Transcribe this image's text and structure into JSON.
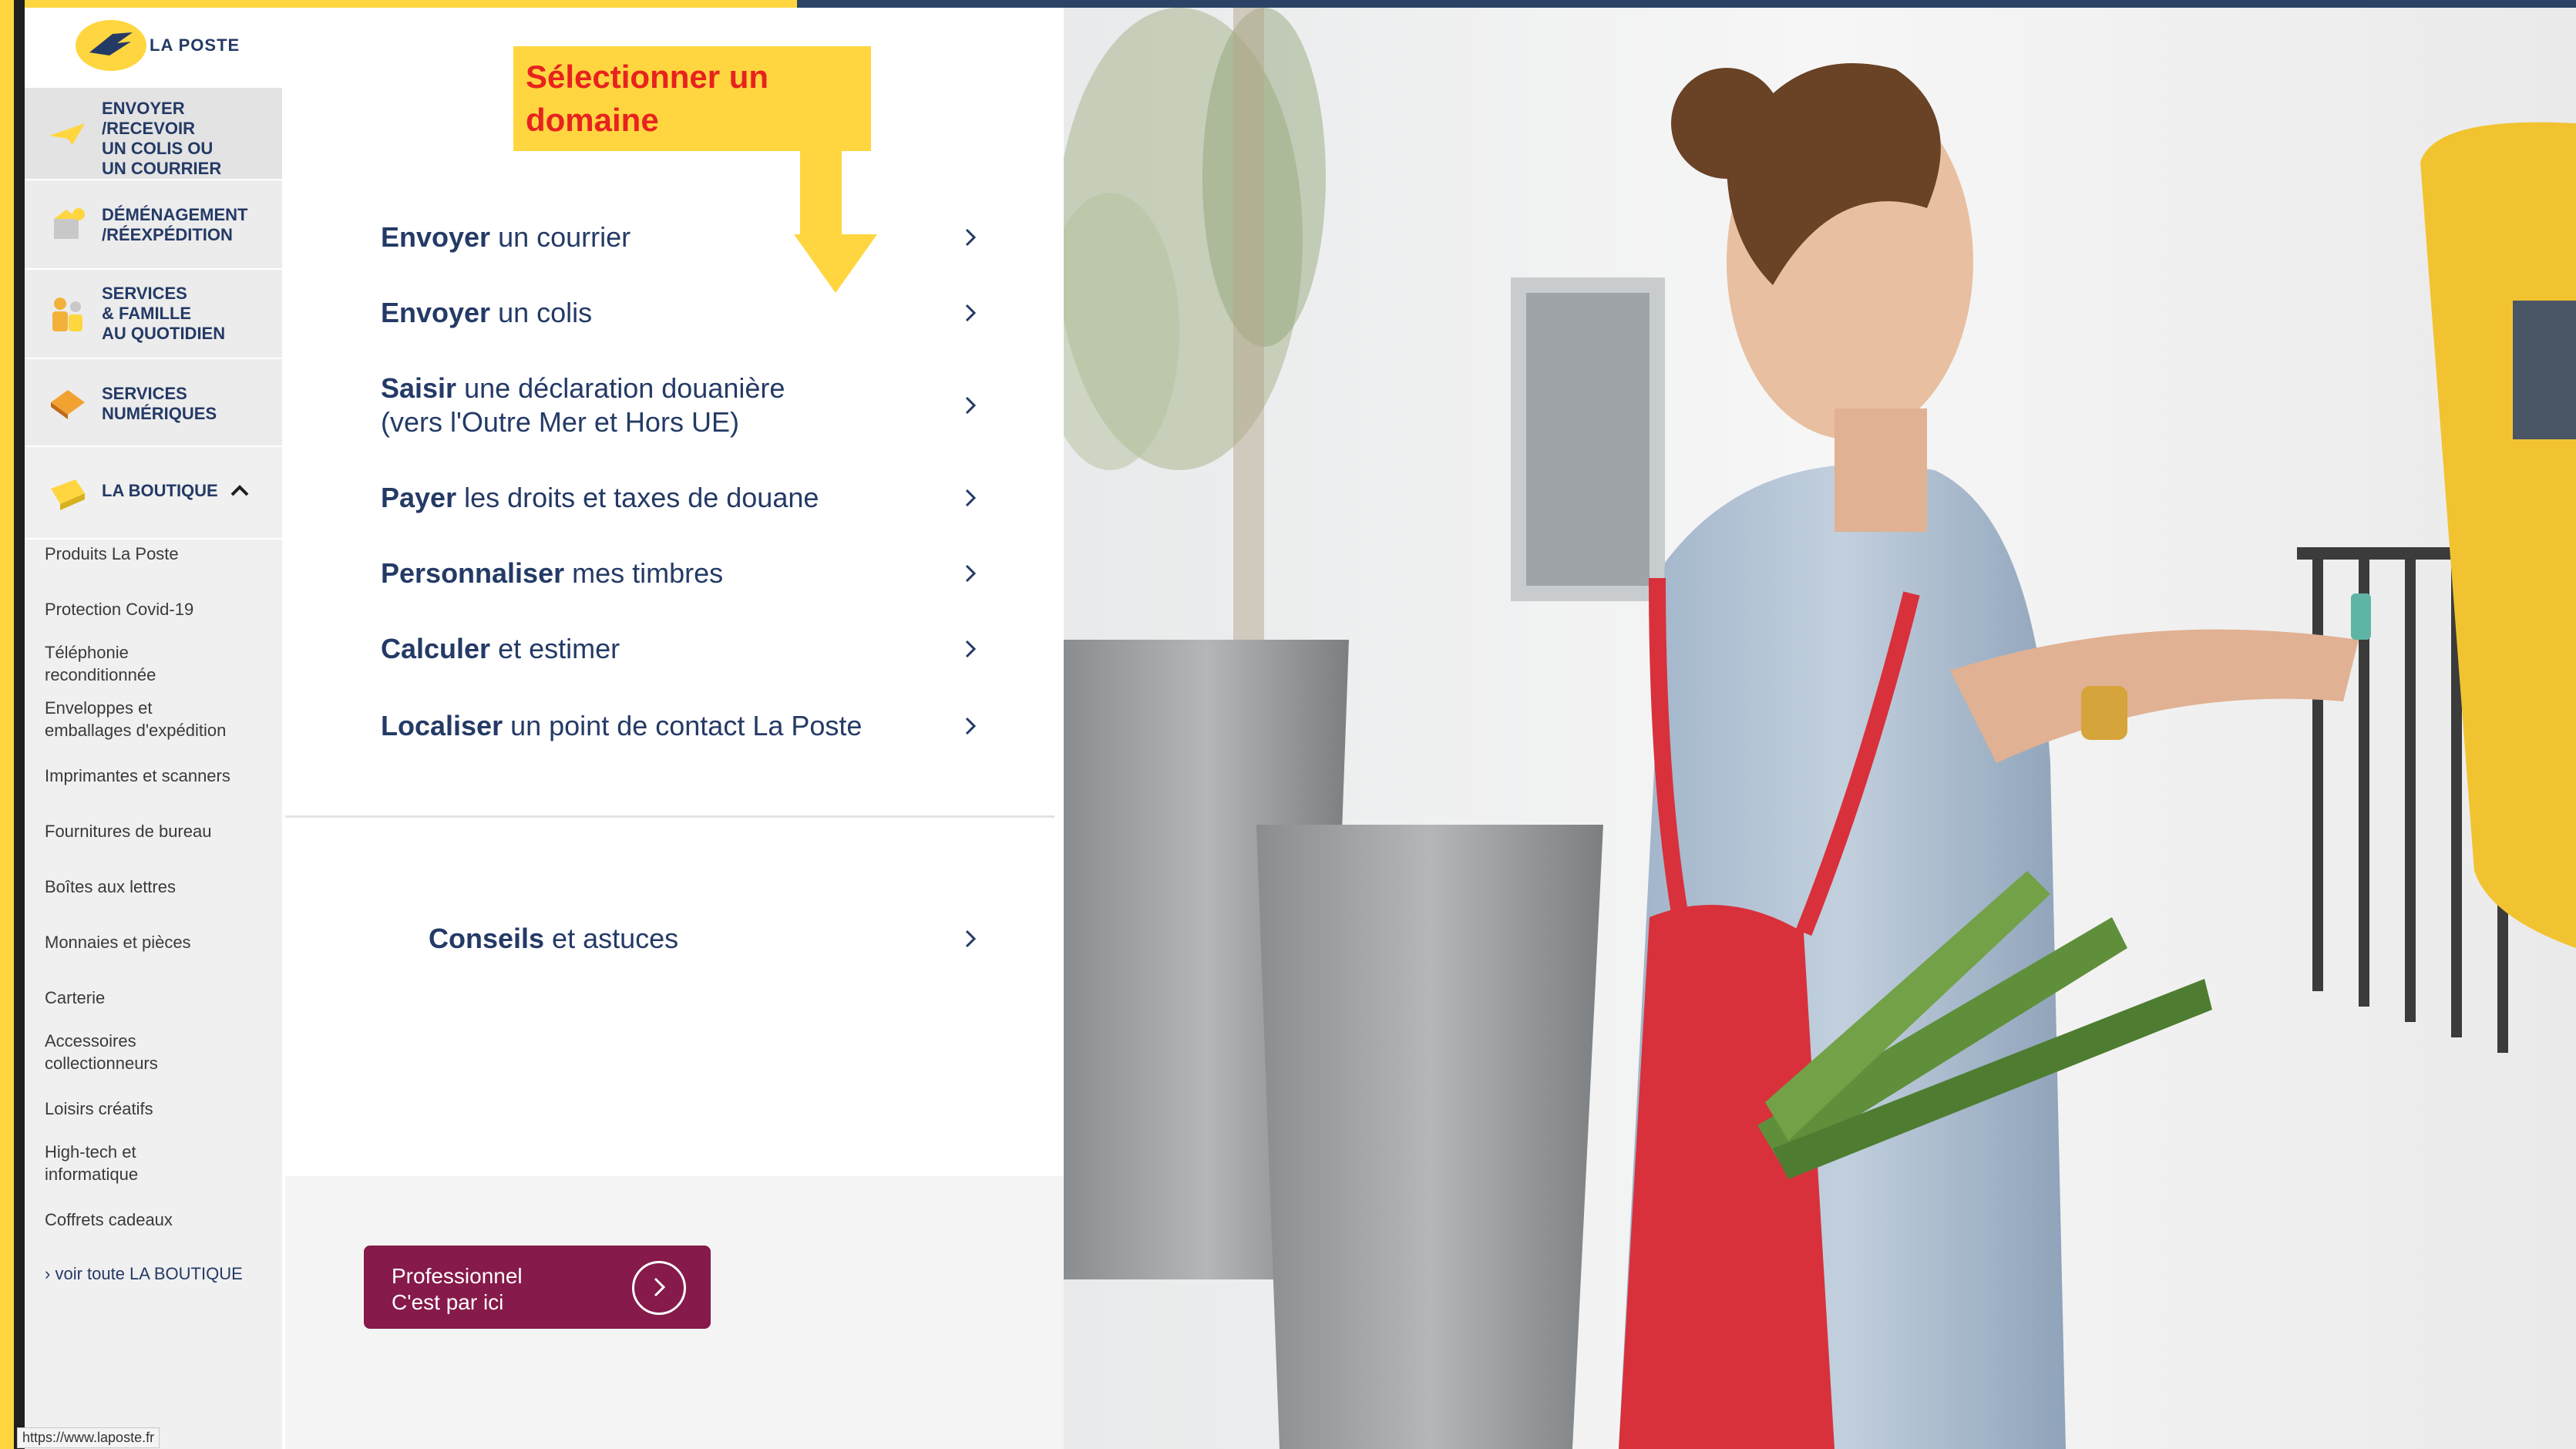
{
  "sidebar": {
    "logo_text": "LA POSTE",
    "nav_items": [
      {
        "label": "ENVOYER\n/RECEVOIR\nUN COLIS OU\nUN COURRIER"
      },
      {
        "label": "DÉMÉNAGEMENT\n/RÉEXPÉDITION"
      },
      {
        "label": "SERVICES\n& FAMILLE\nAU QUOTIDIEN"
      },
      {
        "label": "SERVICES\nNUMÉRIQUES"
      },
      {
        "label": "LA BOUTIQUE"
      }
    ],
    "shop_items": [
      "Produits La Poste",
      "Protection Covid-19",
      "Téléphonie\nreconditionnée",
      "Enveloppes et\nemballages d'expédition",
      "Imprimantes et scanners",
      "Fournitures de bureau",
      "Boîtes aux lettres",
      "Monnaies et pièces",
      "Carterie",
      "Accessoires\ncollectionneurs",
      "Loisirs créatifs",
      "High-tech et\ninformatique",
      "Coffrets cadeaux"
    ],
    "see_all": "voir toute LA BOUTIQUE"
  },
  "callout": {
    "text": "Sélectionner un\ndomaine"
  },
  "menu": [
    {
      "bold": "Envoyer",
      "rest": " un courrier"
    },
    {
      "bold": "Envoyer",
      "rest": " un colis"
    },
    {
      "bold": "Saisir",
      "rest": " une déclaration douanière",
      "rest2": "(vers l'Outre Mer et Hors UE)"
    },
    {
      "bold": "Payer",
      "rest": " les droits et taxes de douane"
    },
    {
      "bold": "Personnaliser",
      "rest": " mes timbres"
    },
    {
      "bold": "Calculer",
      "rest": " et estimer"
    },
    {
      "bold": "Localiser",
      "rest": " un point de contact La Poste"
    }
  ],
  "tips": {
    "bold": "Conseils",
    "rest": " et astuces"
  },
  "pro_button": {
    "line1": "Professionnel",
    "line2": "C'est par ici"
  },
  "status_bar": {
    "url": "https://www.laposte.fr"
  },
  "colors": {
    "brand_yellow": "#FFD640",
    "brand_blue": "#243A66",
    "pro_purple": "#861A4A",
    "callout_red": "#E8221E"
  }
}
